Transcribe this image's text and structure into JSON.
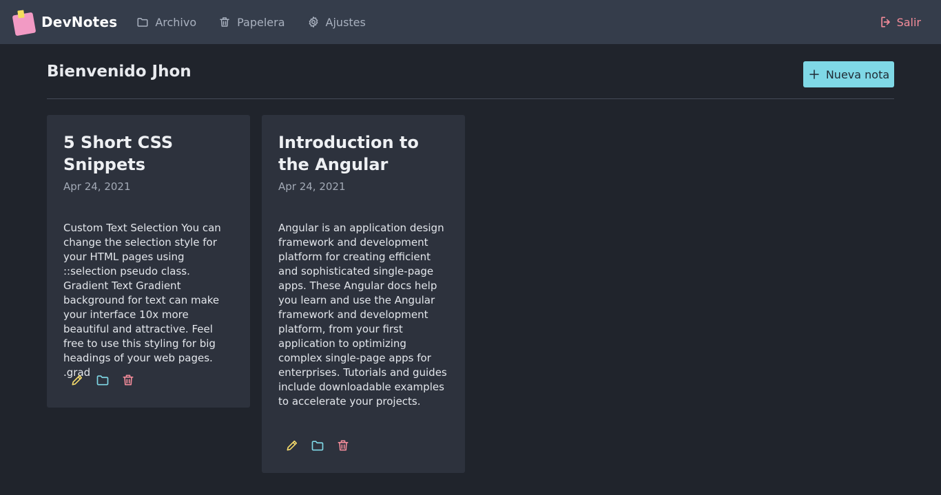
{
  "app": {
    "name": "DevNotes"
  },
  "nav": {
    "items": [
      {
        "label": "Archivo",
        "icon": "folder-icon"
      },
      {
        "label": "Papelera",
        "icon": "trash-icon"
      },
      {
        "label": "Ajustes",
        "icon": "gear-icon"
      }
    ],
    "logout_label": "Salir"
  },
  "header": {
    "title": "Bienvenido Jhon",
    "new_note_label": "Nueva nota"
  },
  "notes": [
    {
      "title": "5 Short CSS Snippets",
      "date": "Apr 24, 2021",
      "body": "Custom Text Selection You can change the selection style for your HTML pages using ::selection pseudo class. Gradient Text Gradient background for text can make your interface 10x more beautiful and attractive. Feel free to use this styling for big headings of your web pages. .grad"
    },
    {
      "title": "Introduction to the Angular",
      "date": "Apr 24, 2021",
      "body": "Angular is an application design framework and development platform for creating efficient and sophisticated single-page apps. These Angular docs help you learn and use the Angular framework and development platform, from your first application to optimizing complex single-page apps for enterprises. Tutorials and guides include downloadable examples to accelerate your projects."
    }
  ],
  "colors": {
    "background": "#20242c",
    "navbar": "#353d4b",
    "card": "#2d323d",
    "accent_button": "#7fd8e6",
    "edit_icon": "#f3d96b",
    "archive_icon": "#7fd8e6",
    "delete_icon": "#f48c9a",
    "logout": "#f48c9a"
  }
}
